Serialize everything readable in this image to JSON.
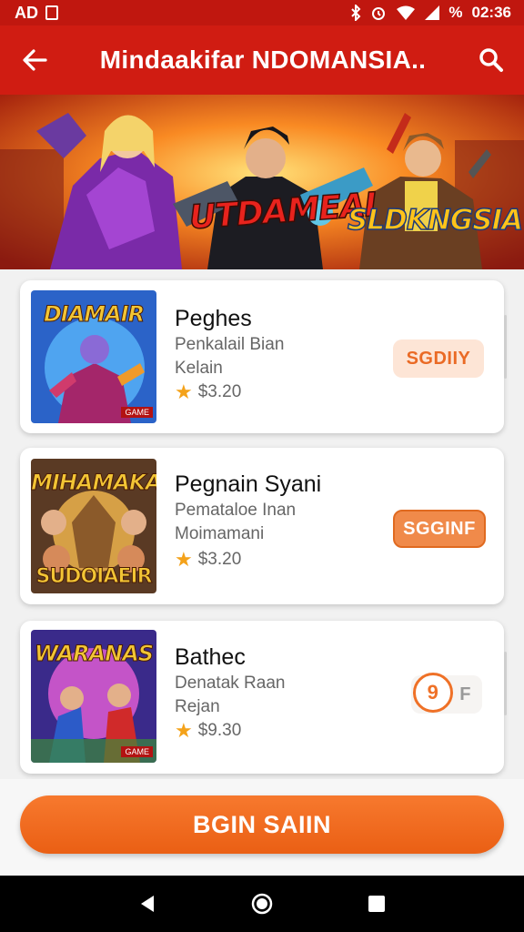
{
  "status_bar": {
    "left_text": "AD",
    "time": "02:36",
    "battery_text": "%"
  },
  "app_bar": {
    "title": "Mindaakifar NDOMANSIA.."
  },
  "banner": {
    "title_left": "UTDAMEAI",
    "title_right": "SLDKNGSIA"
  },
  "items": [
    {
      "thumb_title": "DIAMAIR",
      "thumb_badge": "GAME",
      "title": "Peghes",
      "subtitle_1": "Penkalail Bian",
      "subtitle_2": "Kelain",
      "price": "$3.20",
      "action": "SGDIIY"
    },
    {
      "thumb_title": "MIHAMAKAR",
      "thumb_bottom": "SUDOIAEIR",
      "title": "Pegnain Syani",
      "subtitle_1": "Pemataloe Inan",
      "subtitle_2": "Moimamani",
      "price": "$3.20",
      "action": "SGGINF"
    },
    {
      "thumb_title": "WARANAS",
      "thumb_badge": "GAME",
      "title": "Bathec",
      "subtitle_1": "Denatak Raan",
      "subtitle_2": "Rejan",
      "price": "$9.30",
      "action_number": "9",
      "action_letter": "F"
    }
  ],
  "cta": {
    "label": "BGIN SAIIN"
  },
  "colors": {
    "brand_red": "#d01c12",
    "accent_orange": "#ef7127",
    "star": "#f4a21a"
  },
  "icons": [
    "back-arrow-icon",
    "search-icon",
    "star-icon",
    "nav-back-icon",
    "nav-home-icon",
    "nav-recents-icon",
    "bluetooth-icon",
    "alarm-icon",
    "wifi-icon",
    "signal-icon"
  ]
}
